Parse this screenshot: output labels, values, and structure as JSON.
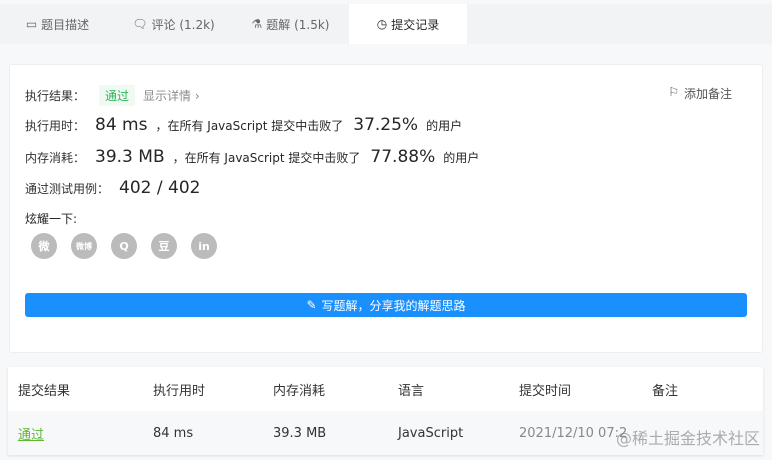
{
  "tabs": [
    {
      "label": "题目描述",
      "icon": "description-icon"
    },
    {
      "label": "评论 (1.2k)",
      "icon": "comment-icon"
    },
    {
      "label": "题解 (1.5k)",
      "icon": "flask-icon"
    },
    {
      "label": "提交记录",
      "icon": "clock-icon"
    }
  ],
  "result": {
    "label": "执行结果：",
    "status": "通过",
    "details": "显示详情 ›",
    "add_note": "添加备注",
    "runtime_label": "执行用时：",
    "runtime": "84 ms",
    "runtime_text": "，在所有 JavaScript 提交中击败了",
    "runtime_pct": "37.25%",
    "users": "的用户",
    "memory_label": "内存消耗：",
    "memory": "39.3 MB",
    "memory_text": "，在所有 JavaScript 提交中击败了",
    "memory_pct": "77.88%",
    "tests_label": "通过测试用例：",
    "tests": "402 / 402",
    "share_label": "炫耀一下:",
    "write_button": "写题解，分享我的解题思路"
  },
  "social": [
    "微",
    "微博",
    "Q",
    "豆",
    "in"
  ],
  "table": {
    "headers": [
      "提交结果",
      "执行用时",
      "内存消耗",
      "语言",
      "提交时间",
      "备注"
    ],
    "rows": [
      {
        "status": "通过",
        "runtime": "84 ms",
        "memory": "39.3 MB",
        "lang": "JavaScript",
        "time": "2021/12/10 07:2"
      }
    ]
  },
  "watermark": "@稀土掘金技术社区",
  "colors": {
    "accent": "#1a90ff",
    "pass": "#2db55d"
  }
}
